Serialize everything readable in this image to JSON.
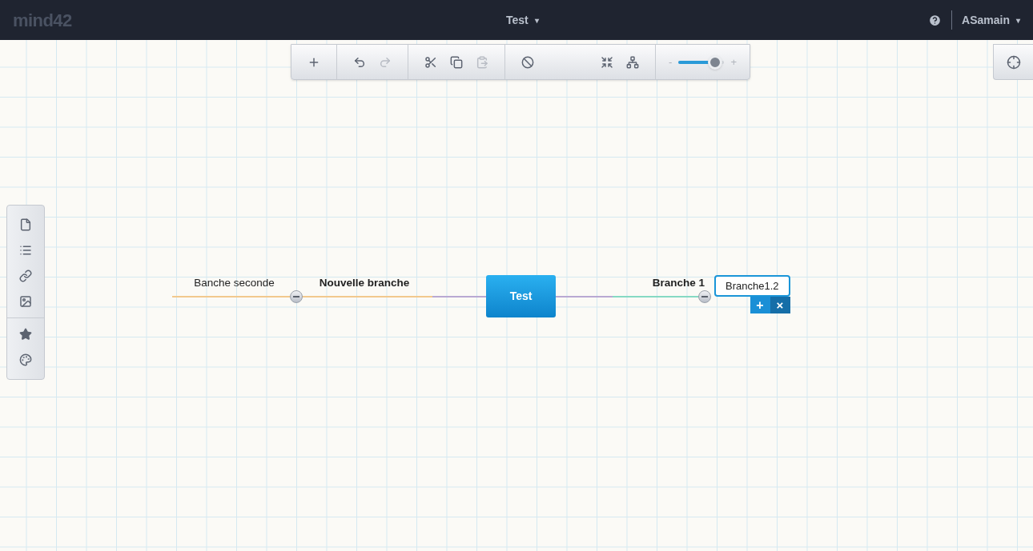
{
  "header": {
    "logo": "mind42",
    "map_title": "Test",
    "map_caret": "▾",
    "user": "ASamain",
    "user_caret": "▾"
  },
  "toolbar": {
    "zoom": {
      "minus": "-",
      "plus": "+",
      "level": 0.85
    }
  },
  "map": {
    "root": {
      "label": "Test",
      "selected": false
    },
    "left_branches": [
      {
        "label": "Nouvelle branche",
        "color": "#f2c98e",
        "expanded": true,
        "selected": false,
        "children": [
          {
            "label": "Banche seconde",
            "color": "#f2c98e",
            "selected": false
          }
        ]
      }
    ],
    "right_branches": [
      {
        "label": "Branche 1",
        "color": "#86d9c4",
        "expanded": true,
        "selected": false,
        "children": [
          {
            "label": "Branche1.2",
            "selected": true
          }
        ]
      }
    ],
    "node_actions": {
      "add": "+",
      "delete": "×"
    }
  }
}
